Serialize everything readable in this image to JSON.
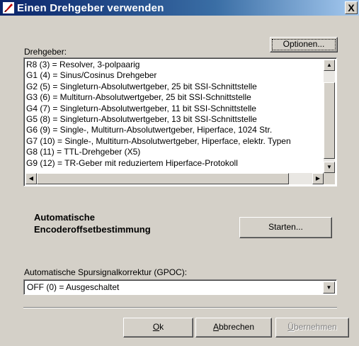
{
  "window": {
    "title": "Einen Drehgeber verwenden",
    "close_label": "X"
  },
  "options_button": {
    "label": "Optionen..."
  },
  "encoder_list": {
    "label": "Drehgeber:",
    "items": [
      "R8 (3) = Resolver, 3-polpaarig",
      "G1 (4) = Sinus/Cosinus Drehgeber",
      "G2 (5) = Singleturn-Absolutwertgeber, 25 bit SSI-Schnittstelle",
      "G3 (6) = Multiturn-Absolutwertgeber, 25 bit SSI-Schnittstelle",
      "G4 (7) = Singleturn-Absolutwertgeber, 11 bit SSI-Schnittstelle",
      "G5 (8) = Singleturn-Absolutwertgeber, 13 bit SSI-Schnittstelle",
      "G6 (9) = Single-, Multiturn-Absolutwertgeber, Hiperface, 1024 Str.",
      "G7 (10) = Single-, Multiturn-Absolutwertgeber, Hiperface,  elektr. Typen",
      "G8 (11) = TTL-Drehgeber (X5)",
      "G9 (12) = TR-Geber mit reduziertem Hiperface-Protokoll"
    ]
  },
  "offset": {
    "label_line1": "Automatische",
    "label_line2": "Encoderoffsetbestimmung",
    "start_button": "Starten..."
  },
  "gpoc": {
    "label": "Automatische Spursignalkorrektur (GPOC):",
    "value": "OFF (0) = Ausgeschaltet"
  },
  "buttons": {
    "ok_mnemonic": "O",
    "ok_rest": "k",
    "cancel_mnemonic": "A",
    "cancel_rest": "bbrechen",
    "apply_mnemonic": "Ü",
    "apply_rest": "bernehmen"
  },
  "colors": {
    "titlebar_start": "#0a246a",
    "titlebar_end": "#a6caf0",
    "face": "#d4d0c8"
  }
}
